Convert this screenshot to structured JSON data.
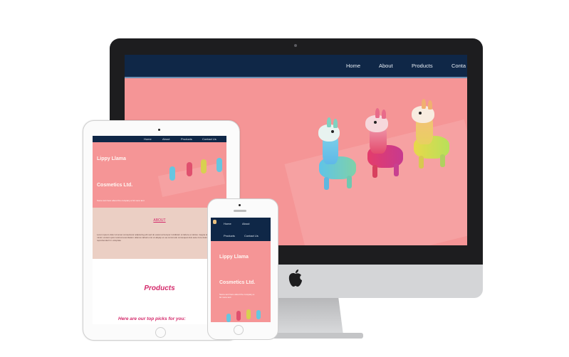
{
  "desktop": {
    "nav": [
      "Home",
      "About",
      "Products",
      "Conta"
    ]
  },
  "tablet": {
    "nav": [
      "Home",
      "About",
      "Products",
      "Contact Us"
    ],
    "hero_line1": "Lippy Llama",
    "hero_line2": "Cosmetics Ltd.",
    "hero_small": "Some text here about the company a bit more text",
    "about_heading": "ABOUT",
    "about_text": "Lorem ipsum dolor sit amet consectetur adipiscing elit sed do eiusmod tempor incididunt ut labore et dolore magna aliqua ut enim ad minim veniam quis nostrud exercitation ullamco laboris nisi ut aliquip ex ea commodo consequat duis aute irure dolor in reprehenderit in voluptate",
    "products_heading": "Products",
    "products_sub": "Here are our top picks for you:"
  },
  "phone": {
    "nav": [
      "Home",
      "About",
      "Products",
      "Contact Us"
    ],
    "hero_line1": "Lippy Llama",
    "hero_line2": "Cosmetics Ltd.",
    "hero_small": "Some text here about the company a bit more text"
  },
  "colors": {
    "nav": "#0f2747",
    "hero": "#f59596",
    "about": "#ebcfc4",
    "accent": "#d42a6b"
  }
}
